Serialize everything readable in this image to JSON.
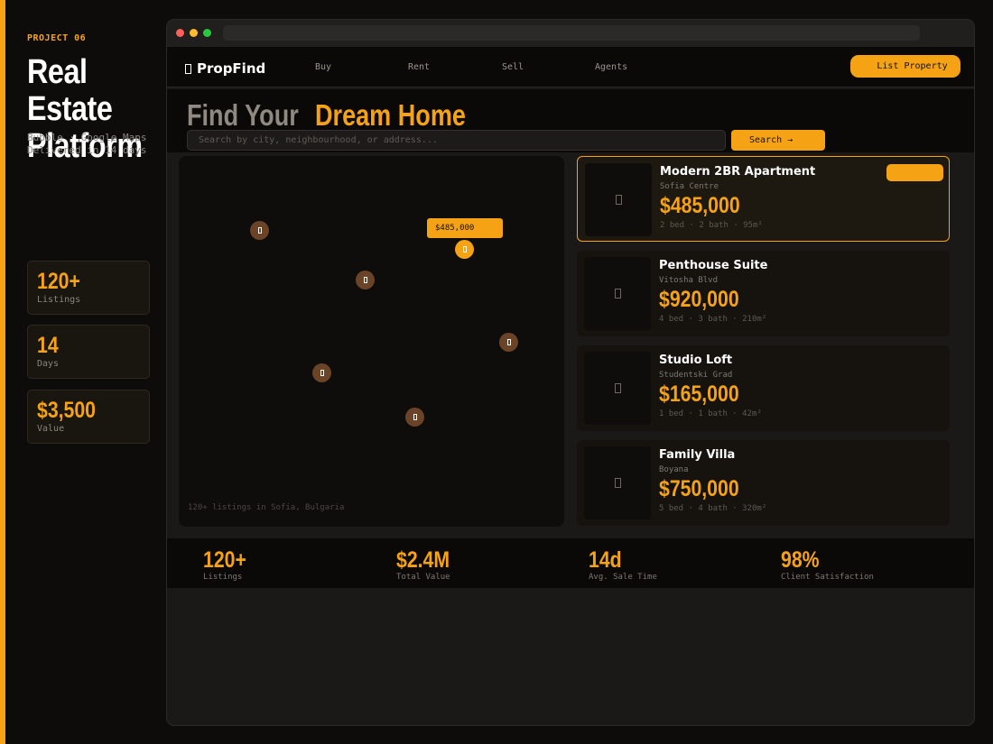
{
  "project": {
    "number": "PROJECT 06",
    "title_line1": "Real Estate",
    "title_line2": "Platform",
    "subtitle_line1": "Bubble · Google Maps",
    "subtitle_line2": "Delivered in 14 days",
    "stats": [
      {
        "value": "120+",
        "label": "Listings"
      },
      {
        "value": "14",
        "label": "Days"
      },
      {
        "value": "$3,500",
        "label": "Value"
      }
    ]
  },
  "app": {
    "logo": "PropFind",
    "nav": [
      "Buy",
      "Rent",
      "Sell",
      "Agents"
    ],
    "list_property_label": "List Property",
    "hero_part1": "Find Your",
    "hero_part2": "Dream Home",
    "search_placeholder": "Search by city, neighbourhood, or address...",
    "search_button_label": "Search →",
    "map": {
      "price_tag": "$485,000",
      "caption": "120+ listings in Sofia, Bulgaria"
    },
    "listings": [
      {
        "title": "Modern 2BR Apartment",
        "location": "Sofia Centre",
        "price": "$485,000",
        "beds": "2 bed",
        "baths": "2 bath",
        "area": "95m²",
        "featured": true
      },
      {
        "title": "Penthouse Suite",
        "location": "Vitosha Blvd",
        "price": "$920,000",
        "beds": "4 bed",
        "baths": "3 bath",
        "area": "210m²"
      },
      {
        "title": "Studio Loft",
        "location": "Studentski Grad",
        "price": "$165,000",
        "beds": "1 bed",
        "baths": "1 bath",
        "area": "42m²"
      },
      {
        "title": "Family Villa",
        "location": "Boyana",
        "price": "$750,000",
        "beds": "5 bed",
        "baths": "4 bath",
        "area": "320m²"
      }
    ],
    "stats": [
      {
        "value": "120+",
        "label": "Listings"
      },
      {
        "value": "$2.4M",
        "label": "Total Value"
      },
      {
        "value": "14d",
        "label": "Avg. Sale Time"
      },
      {
        "value": "98%",
        "label": "Client Satisfaction"
      }
    ]
  },
  "colors": {
    "accent": "#f5a315",
    "pin": "#6b4428",
    "window_dot_red": "#ff5f57",
    "window_dot_yellow": "#febc2e",
    "window_dot_green": "#28c840"
  }
}
